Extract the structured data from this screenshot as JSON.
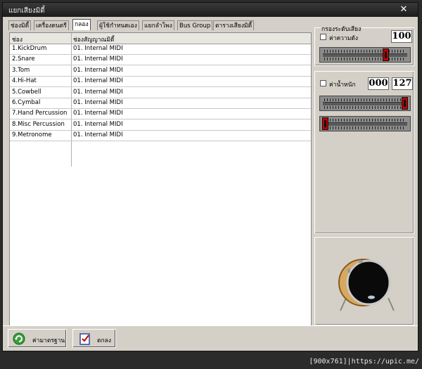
{
  "window": {
    "title": "แยกเสียงมิดี้"
  },
  "tabs": [
    {
      "label": "ช่องมิดี้"
    },
    {
      "label": "เครื่องดนตรี"
    },
    {
      "label": "กลอง",
      "active": true
    },
    {
      "label": "ผู้ใช้กำหนดเอง"
    },
    {
      "label": "แยกลำโพง"
    },
    {
      "label": "Bus Group"
    },
    {
      "label": "ตารางเสียงมิดี้"
    }
  ],
  "table": {
    "headers": [
      "ช่อง",
      "ช่องสัญญาณมิดี้"
    ],
    "rows": [
      [
        "1.KickDrum",
        "01. Internal MIDI"
      ],
      [
        "2.Snare",
        "01. Internal MIDI"
      ],
      [
        "3.Tom",
        "01. Internal MIDI"
      ],
      [
        "4.Hi-Hat",
        "01. Internal MIDI"
      ],
      [
        "5.Cowbell",
        "01. Internal MIDI"
      ],
      [
        "6.Cymbal",
        "01. Internal MIDI"
      ],
      [
        "7.Hand Percussion",
        "01. Internal MIDI"
      ],
      [
        "8.Misc Percussion",
        "01. Internal MIDI"
      ],
      [
        "9.Metronome",
        "01. Internal MIDI"
      ]
    ]
  },
  "volume_filter": {
    "legend": "กรองระดับเสียง",
    "checkbox_label": "ค่าความดัง",
    "value": "100",
    "slider_level": 0.76
  },
  "velocity": {
    "checkbox_label": "ค่าน้ำหนัก",
    "min_value": "000",
    "max_value": "127",
    "max_slider_level": 1.0,
    "min_slider_level": 0.0
  },
  "buttons": {
    "default_label": "ค่ามาตรฐาน",
    "ok_label": "ตกลง"
  },
  "footer": {
    "size": "[900x761]",
    "url": "https://upic.me/"
  },
  "colors": {
    "slider_thumb": "#c00000",
    "drum_head": "#0a0a0a",
    "drum_shell": "#d7a860"
  }
}
